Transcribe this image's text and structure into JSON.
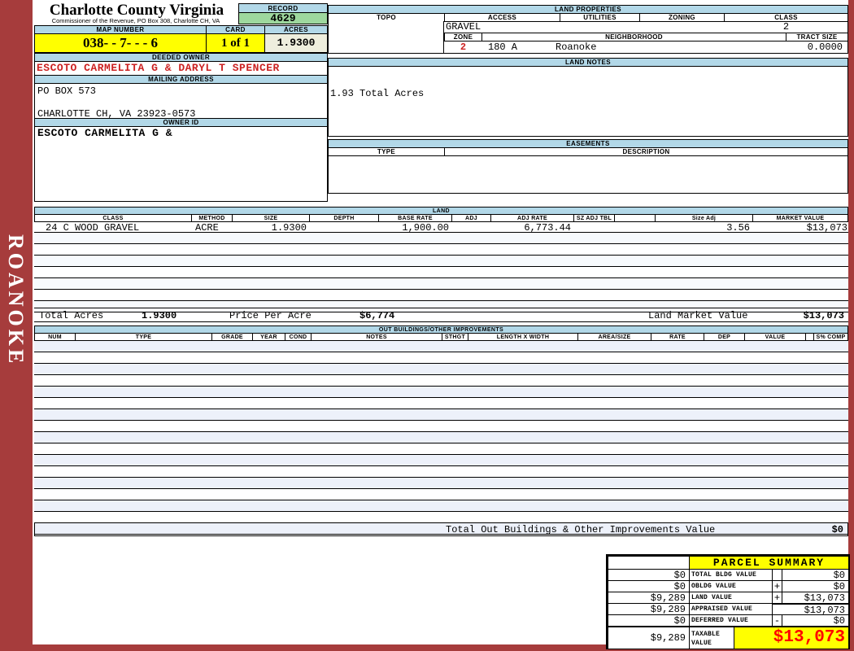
{
  "colors": {
    "sidebar_red": "#a63c3c",
    "header_blue": "#b2d8e8",
    "record_green": "#9ed89e",
    "highlight_yellow": "#ffff00",
    "acres_cream": "#eeeedd",
    "owner_red": "#cc2222",
    "taxable_red": "#ff0000"
  },
  "sidebar": {
    "district_label": "ROANOKE"
  },
  "header": {
    "county_title": "Charlotte County Virginia",
    "county_subtitle": "Commissioner of the Revenue, PO Box 308, Charlotte CH, VA",
    "record_label": "RECORD",
    "record_value": "4629",
    "map_number_label": "MAP NUMBER",
    "map_number_value": "038- - 7- - - 6",
    "card_label": "CARD",
    "card_value": "1 of 1",
    "acres_label": "ACRES",
    "acres_value": "1.9300"
  },
  "owner": {
    "deeded_owner_label": "DEEDED OWNER",
    "deeded_owner": "ESCOTO CARMELITA G & DARYL T SPENCER",
    "mailing_address_label": "MAILING ADDRESS",
    "address_line1": "PO BOX 573",
    "address_line2": "CHARLOTTE CH, VA 23923-0573",
    "owner_id_label": "OWNER ID",
    "owner_id": "ESCOTO CARMELITA G &"
  },
  "land_properties": {
    "title": "LAND PROPERTIES",
    "topo_label": "TOPO",
    "access_label": "ACCESS",
    "utilities_label": "UTILITIES",
    "zoning_label": "ZONING",
    "class_label": "CLASS",
    "access_value": "GRAVEL",
    "class_value": "2",
    "zone_label": "ZONE",
    "zone_value": "2",
    "zone_area": "180 A",
    "neighborhood_label": "NEIGHBORHOOD",
    "neighborhood_value": "Roanoke",
    "tract_size_label": "TRACT SIZE",
    "tract_size_value": "0.0000"
  },
  "land_notes": {
    "title": "LAND NOTES",
    "note": "1.93 Total Acres"
  },
  "easements": {
    "title": "EASEMENTS",
    "type_label": "TYPE",
    "description_label": "DESCRIPTION"
  },
  "land": {
    "title": "LAND",
    "columns": [
      "CLASS",
      "METHOD",
      "SIZE",
      "DEPTH",
      "BASE RATE",
      "ADJ",
      "ADJ RATE",
      "SZ ADJ TBL",
      "",
      "Size Adj",
      "MARKET VALUE"
    ],
    "rows": [
      {
        "class": "24 C WOOD GRAVEL",
        "method": "ACRE",
        "size": "1.9300",
        "depth": "",
        "base_rate": "1,900.00",
        "adj": "",
        "adj_rate": "6,773.44",
        "sz_adj_tbl": "",
        "size_adj": "3.56",
        "market_value": "$13,073"
      }
    ],
    "total_acres_label": "Total Acres",
    "total_acres_value": "1.9300",
    "price_per_acre_label": "Price Per Acre",
    "price_per_acre_value": "$6,774",
    "land_market_value_label": "Land Market Value",
    "land_market_value": "$13,073"
  },
  "out_buildings": {
    "title": "OUT BUILDINGS/OTHER IMPROVEMENTS",
    "columns": [
      "NUM",
      "TYPE",
      "GRADE",
      "YEAR",
      "COND",
      "NOTES",
      "STHGT",
      "LENGTH X WIDTH",
      "AREA/SIZE",
      "RATE",
      "DEP",
      "VALUE",
      "S% COMP"
    ],
    "total_label": "Total Out Buildings & Other Improvements Value",
    "total_value": "$0"
  },
  "parcel_summary": {
    "title": "PARCEL SUMMARY",
    "rows": [
      {
        "left": "$0",
        "label": "TOTAL BLDG VALUE",
        "op": "",
        "right": "$0"
      },
      {
        "left": "$0",
        "label": "OBLDG VALUE",
        "op": "+",
        "right": "$0"
      },
      {
        "left": "$9,289",
        "label": "LAND VALUE",
        "op": "+",
        "right": "$13,073"
      },
      {
        "left": "$9,289",
        "label": "APPRAISED VALUE",
        "op": "",
        "right": "$13,073"
      },
      {
        "left": "$0",
        "label": "DEFERRED VALUE",
        "op": "-",
        "right": "$0"
      },
      {
        "left": "$9,289",
        "label": "TAXABLE VALUE",
        "op": "",
        "right": "$13,073"
      }
    ]
  }
}
